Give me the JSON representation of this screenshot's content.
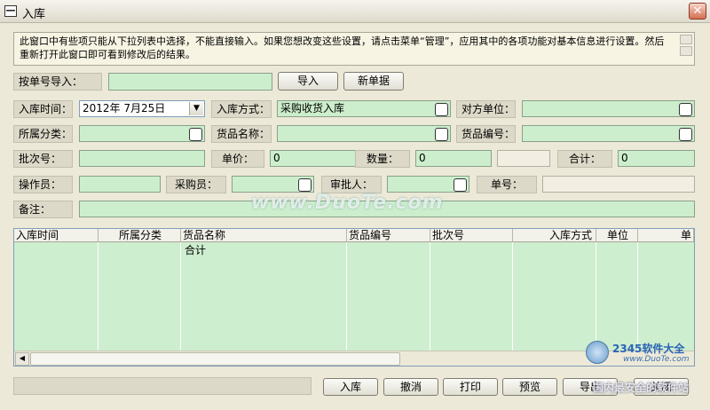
{
  "window": {
    "title": "入库",
    "close_glyph": "✕",
    "sys_glyph": "—"
  },
  "notice": "此窗口中有些项只能从下拉列表中选择，不能直接输入。如果您想改变这些设置，请点击菜单“管理”，应用其中的各项功能对基本信息进行设置。然后重新打开此窗口即可看到修改后的结果。",
  "import_row": {
    "label": "按单号导入：",
    "value": "",
    "import_button": "导入",
    "new_button": "新单据"
  },
  "form": {
    "date_label": "入库时间：",
    "date_value": "2012年 7月25日",
    "method_label": "入库方式：",
    "method_value": "采购收货入库",
    "counterparty_label": "对方单位：",
    "counterparty_value": "",
    "category_label": "所属分类：",
    "category_value": "",
    "goods_name_label": "货品名称：",
    "goods_name_value": "",
    "goods_code_label": "货品编号：",
    "goods_code_value": "",
    "batch_label": "批次号：",
    "batch_value": "",
    "price_label": "单价：",
    "price_value": "0",
    "qty_label": "数量：",
    "qty_value": "0",
    "total_label": "合计：",
    "total_value": "0",
    "operator_label": "操作员：",
    "operator_value": "",
    "buyer_label": "采购员：",
    "buyer_value": "",
    "approver_label": "审批人：",
    "approver_value": "",
    "order_no_label": "单号：",
    "order_no_value": "",
    "remark_label": "备注：",
    "remark_value": ""
  },
  "grid": {
    "columns": [
      "入库时间",
      "所属分类",
      "货品名称",
      "货品编号",
      "批次号",
      "入库方式",
      "单位",
      "单"
    ],
    "summary_label": "合计"
  },
  "footer": {
    "status": "",
    "buttons": [
      "入库",
      "撤消",
      "打印",
      "预览",
      "导出",
      "关闭"
    ]
  },
  "watermarks": {
    "duote": "www.DuoTe.com",
    "brand": "2345软件大全",
    "brand_url": "www.DuoTe.com",
    "overlay": "国内最安全的软件站"
  }
}
